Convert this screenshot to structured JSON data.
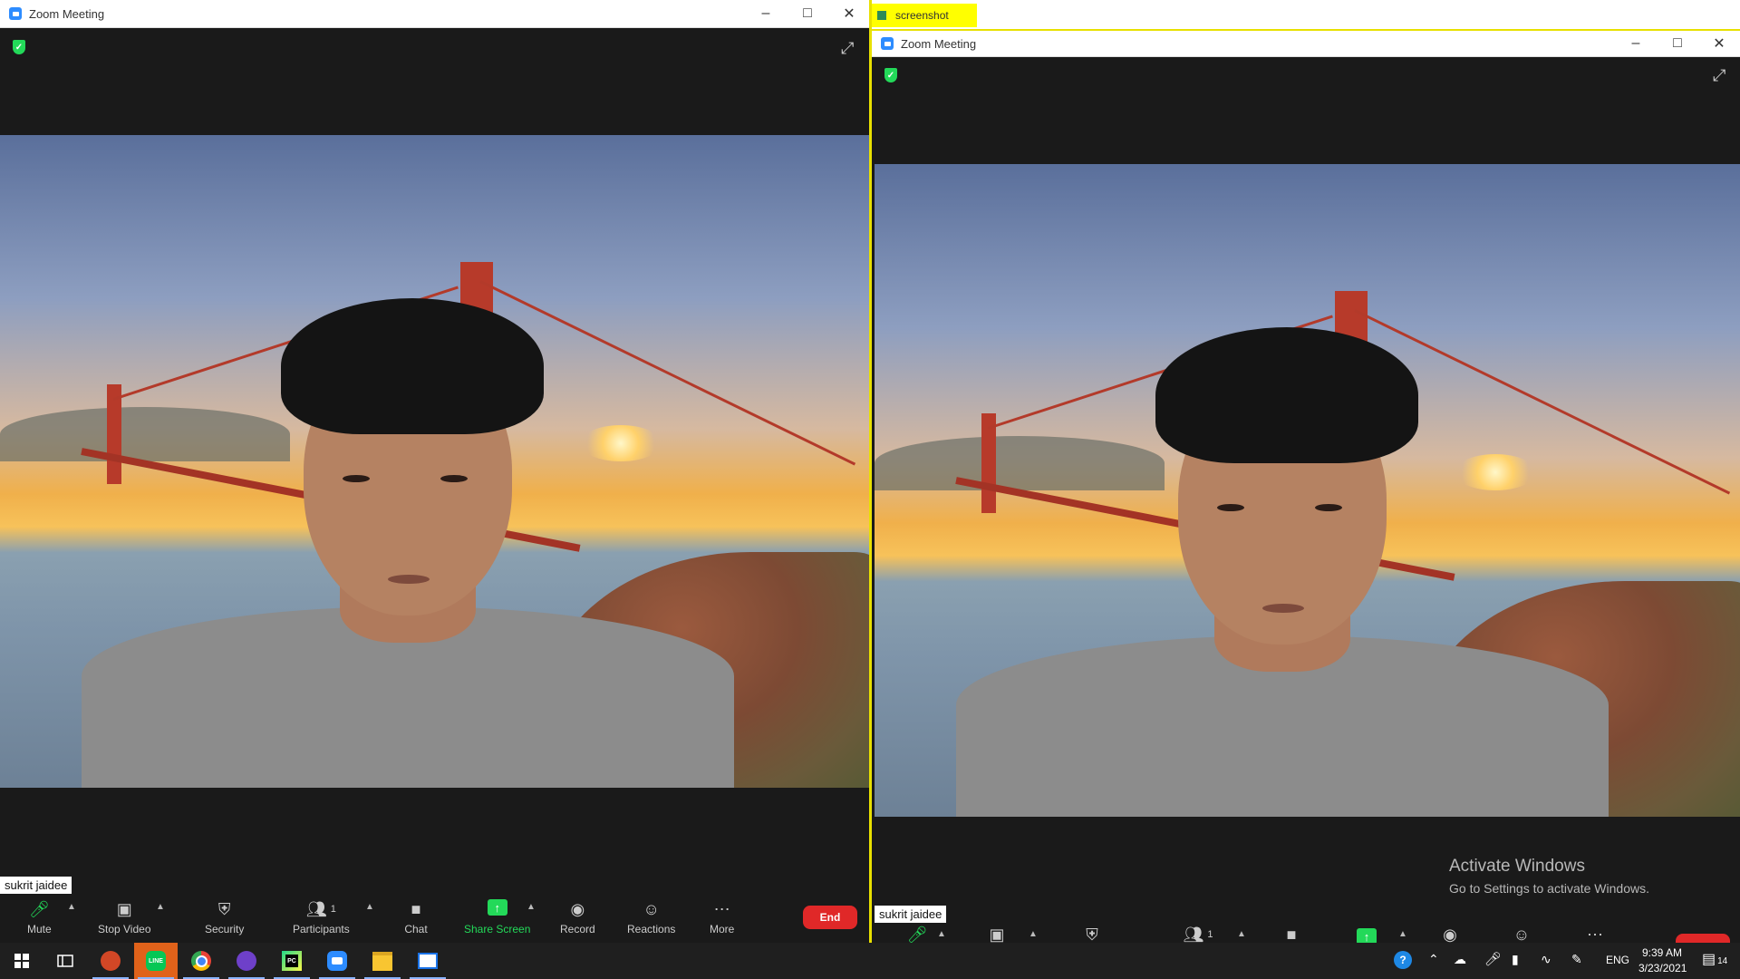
{
  "left_window": {
    "title": "Zoom Meeting",
    "name_tag": "sukrit jaidee",
    "toolbar": {
      "mute": "Mute",
      "stop_video": "Stop Video",
      "security": "Security",
      "participants": "Participants",
      "participants_count": "1",
      "chat": "Chat",
      "share_screen": "Share Screen",
      "record": "Record",
      "reactions": "Reactions",
      "more": "More",
      "end": "End"
    }
  },
  "screenshot_tab": {
    "title": "screenshot"
  },
  "right_window": {
    "title": "Zoom Meeting",
    "name_tag": "sukrit jaidee",
    "participants_count": "1"
  },
  "activate_windows": {
    "title": "Activate Windows",
    "subtitle": "Go to Settings to activate Windows."
  },
  "taskbar": {
    "language": "ENG",
    "time": "9:39 AM",
    "date": "3/23/2021",
    "notification_count": "14",
    "apps": [
      "windows-start",
      "task-view",
      "powerpoint",
      "line",
      "chrome",
      "github",
      "pycharm",
      "zoom",
      "file-explorer",
      "screenshot-app"
    ]
  },
  "colors": {
    "share_green": "#23d959",
    "end_red": "#e02828",
    "highlight_yellow": "#ffff00"
  }
}
